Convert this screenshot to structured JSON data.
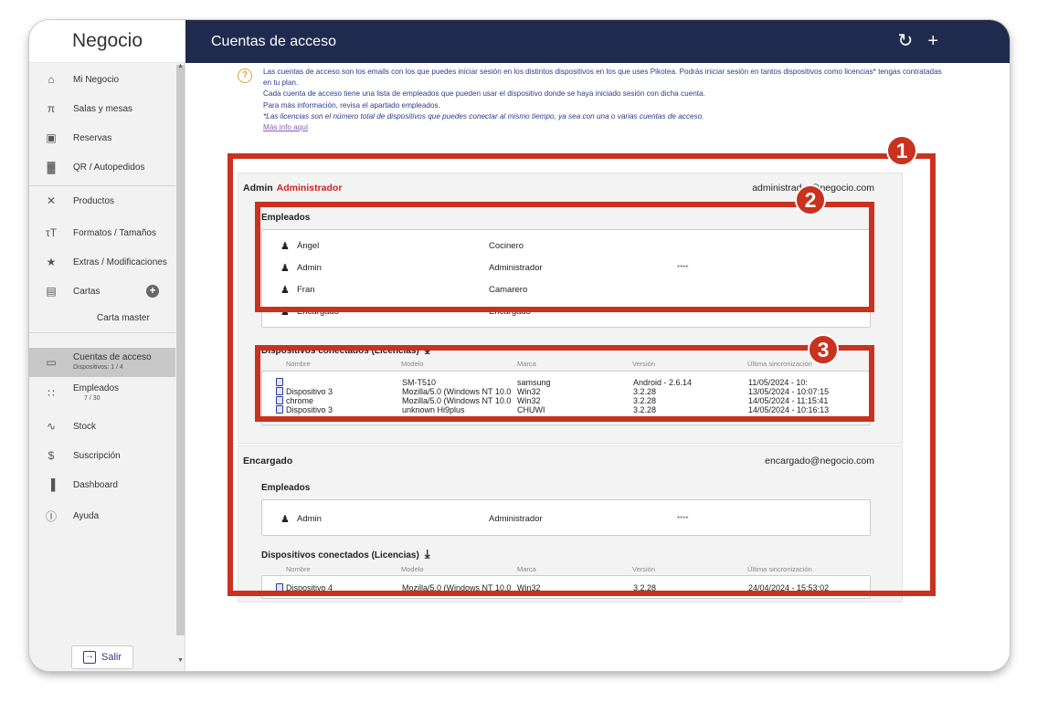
{
  "app": {
    "brand": "Negocio",
    "page_title": "Cuentas de acceso",
    "refresh_icon": "refresh-icon",
    "add_icon": "plus-icon",
    "header_color": "#1f2a4e",
    "accent_red": "#c8321f"
  },
  "sidebar": {
    "items": [
      {
        "label": "Mi Negocio",
        "icon": "home-icon"
      },
      {
        "label": "Salas y mesas",
        "icon": "table-icon"
      },
      {
        "label": "Reservas",
        "icon": "calendar-icon"
      },
      {
        "label": "QR / Autopedidos",
        "icon": "qr-icon"
      },
      {
        "label": "Productos",
        "icon": "cutlery-icon"
      },
      {
        "label": "Formatos / Tamaños",
        "icon": "text-size-icon"
      },
      {
        "label": "Extras / Modificaciones",
        "icon": "star-icon"
      },
      {
        "label": "Cartas",
        "icon": "menu-book-icon"
      },
      {
        "label": "Cuentas de acceso",
        "sub": "Dispositivos: 1 / 4",
        "icon": "device-icon"
      },
      {
        "label": "Empleados",
        "sub": "7 / 30",
        "icon": "people-icon"
      },
      {
        "label": "Stock",
        "icon": "trend-icon"
      },
      {
        "label": "Suscripción",
        "icon": "dollar-icon"
      },
      {
        "label": "Dashboard",
        "icon": "bar-chart-icon"
      },
      {
        "label": "Ayuda",
        "icon": "help-icon"
      }
    ],
    "carta_master": "Carta master",
    "logout_label": "Salir"
  },
  "info": {
    "line1": "Las cuentas de acceso son los emails con los que puedes iniciar sesión en los distintos dispositivos en los que uses Pikotea. Podrás iniciar sesión en tantos dispositivos como licencias* tengas contratadas en tu plan.",
    "line2": "Cada cuenta de acceso tiene una lista de empleados que pueden usar el dispositivo donde se haya iniciado sesión con dicha cuenta.",
    "line3": "Para más información, revisa el apartado empleados.",
    "line4": "*Las licencias son el número total de dispositivos que puedes conectar al mismo tiempo, ya sea con una o varias cuentas de acceso.",
    "link": "Más info aquí"
  },
  "labels": {
    "employees": "Empleados",
    "devices": "Dispositivos conectados (Licencias)",
    "col_name": "Nombre",
    "col_model": "Modelo",
    "col_brand": "Marca",
    "col_version": "Versión",
    "col_sync": "Última sincronización"
  },
  "accounts": [
    {
      "name": "Admin",
      "role": "Administrador",
      "email": "administrador@negocio.com",
      "employees": [
        {
          "name": "Ángel",
          "role": "Cocinero",
          "pin": ""
        },
        {
          "name": "Admin",
          "role": "Administrador",
          "pin": "****"
        },
        {
          "name": "Fran",
          "role": "Camarero",
          "pin": ""
        },
        {
          "name": "Encargado",
          "role": "Encargado",
          "pin": ""
        }
      ],
      "devices": [
        {
          "name": "",
          "model": "SM-T510",
          "brand": "samsung",
          "version": "Android - 2.6.14",
          "sync": "11/05/2024 - 10:"
        },
        {
          "name": "Dispositivo 3",
          "model": "Mozilla/5.0 (Windows NT 10.0",
          "brand": "Win32",
          "version": "3.2.28",
          "sync": "13/05/2024 - 10:07:15"
        },
        {
          "name": "chrome",
          "model": "Mozilla/5.0 (Windows NT 10.0",
          "brand": "Win32",
          "version": "3.2.28",
          "sync": "14/05/2024 - 11:15:41"
        },
        {
          "name": "Dispositivo 3",
          "model": "unknown Hi9plus",
          "brand": "CHUWI",
          "version": "3.2.28",
          "sync": "14/05/2024 - 10:16:13"
        }
      ]
    },
    {
      "name": "Encargado",
      "role": "",
      "email": "encargado@negocio.com",
      "employees": [
        {
          "name": "Admin",
          "role": "Administrador",
          "pin": "****"
        }
      ],
      "devices": [
        {
          "name": "Dispositivo 4",
          "model": "Mozilla/5.0 (Windows NT 10.0",
          "brand": "Win32",
          "version": "3.2.28",
          "sync": "24/04/2024 - 15:53:02"
        }
      ]
    }
  ],
  "badges": [
    "1",
    "2",
    "3"
  ]
}
